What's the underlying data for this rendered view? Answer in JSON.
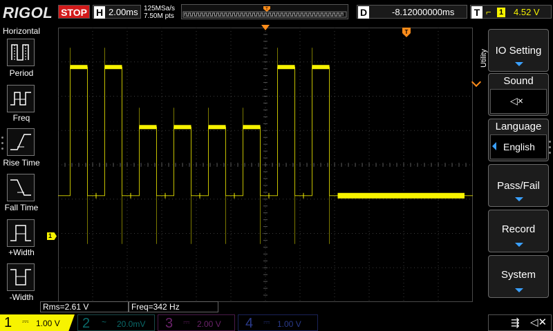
{
  "brand": "RIGOL",
  "run_state": "STOP",
  "timebase": {
    "letter": "H",
    "value": "2.00ms",
    "sample_rate": "125MSa/s",
    "points": "7.50M pts"
  },
  "delay": {
    "letter": "D",
    "value": "-8.12000000ms"
  },
  "trigger": {
    "letter": "T",
    "source": "1",
    "level": "4.52 V"
  },
  "left_menu": {
    "title": "Horizontal",
    "items": [
      {
        "label": "Period",
        "icon": "period-icon"
      },
      {
        "label": "Freq",
        "icon": "freq-icon"
      },
      {
        "label": "Rise Time",
        "icon": "rise-time-icon"
      },
      {
        "label": "Fall Time",
        "icon": "fall-time-icon"
      },
      {
        "label": "+Width",
        "icon": "positive-width-icon"
      },
      {
        "label": "-Width",
        "icon": "negative-width-icon"
      }
    ]
  },
  "measurements": {
    "rms": "Rms=2.61 V",
    "freq": "Freq=342 Hz"
  },
  "channels": [
    {
      "num": "1",
      "coupling": "⎓",
      "scale": "1.00 V",
      "color": "#f7f300"
    },
    {
      "num": "2",
      "coupling": "~",
      "scale": "20.0mV",
      "color": "#00b8b8"
    },
    {
      "num": "3",
      "coupling": "⎓",
      "scale": "2.00 V",
      "color": "#d040d0"
    },
    {
      "num": "4",
      "coupling": "⎓",
      "scale": "1.00 V",
      "color": "#4060e0"
    }
  ],
  "channel1_marker": "1",
  "right_menu": {
    "header": "Utility",
    "items": [
      {
        "label": "IO Setting"
      },
      {
        "label": "Sound"
      },
      {
        "label": "Language",
        "value": "English"
      },
      {
        "label": "Pass/Fail"
      },
      {
        "label": "Record"
      },
      {
        "label": "System"
      }
    ]
  },
  "trace": {
    "color": "#f7f300",
    "levels_div": {
      "low": -0.9,
      "mid": 1.1,
      "high": 2.85
    },
    "pulses": [
      {
        "start": 0.35,
        "end": 0.85,
        "level": "high"
      },
      {
        "start": 1.35,
        "end": 1.85,
        "level": "high"
      },
      {
        "start": 2.35,
        "end": 2.85,
        "level": "mid"
      },
      {
        "start": 3.35,
        "end": 3.85,
        "level": "mid"
      },
      {
        "start": 4.35,
        "end": 4.85,
        "level": "mid"
      },
      {
        "start": 5.35,
        "end": 5.85,
        "level": "mid"
      },
      {
        "start": 6.35,
        "end": 6.85,
        "level": "high"
      },
      {
        "start": 7.35,
        "end": 7.85,
        "level": "high"
      }
    ]
  }
}
